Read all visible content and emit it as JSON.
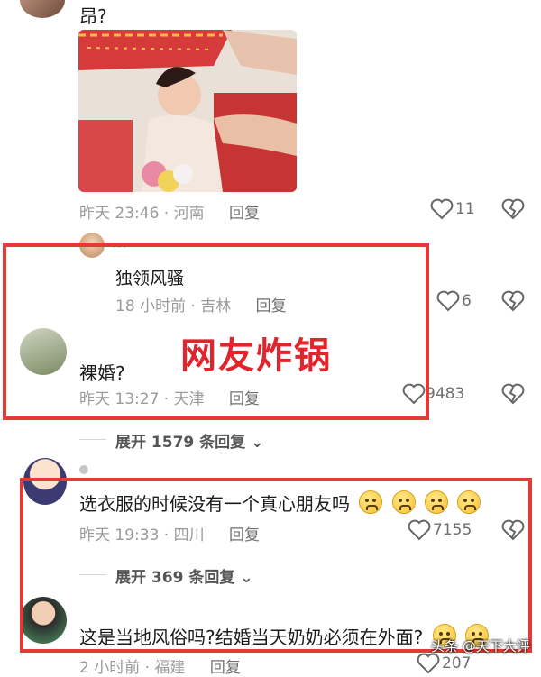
{
  "comment_top": {
    "text": "昂?",
    "time": "昨天 23:46 · 河南",
    "reply_label": "回复",
    "likes": "11"
  },
  "comment_reply1": {
    "author": "…",
    "text": "独领风骚",
    "time": "18 小时前 · 吉林",
    "reply_label": "回复",
    "likes": "6"
  },
  "comment_main1": {
    "text": "裸婚?",
    "time": "昨天 13:27 · 天津",
    "reply_label": "回复",
    "likes": "9483",
    "expand": "展开 1579 条回复"
  },
  "overlay_caption": "网友炸锅",
  "comment_main2": {
    "text": "选衣服的时候没有一个真心朋友吗",
    "time": "昨天 19:33 · 四川",
    "reply_label": "回复",
    "likes": "7155",
    "expand": "展开 369 条回复"
  },
  "comment_main3": {
    "text": "这是当地风俗吗?结婚当天奶奶必须在外面?",
    "time": "2 小时前 · 福建",
    "reply_label": "回复",
    "likes": "207"
  },
  "watermark": "头条 @天下大评",
  "colors": {
    "highlight_box": "#e53935",
    "caption": "#e0262c"
  }
}
